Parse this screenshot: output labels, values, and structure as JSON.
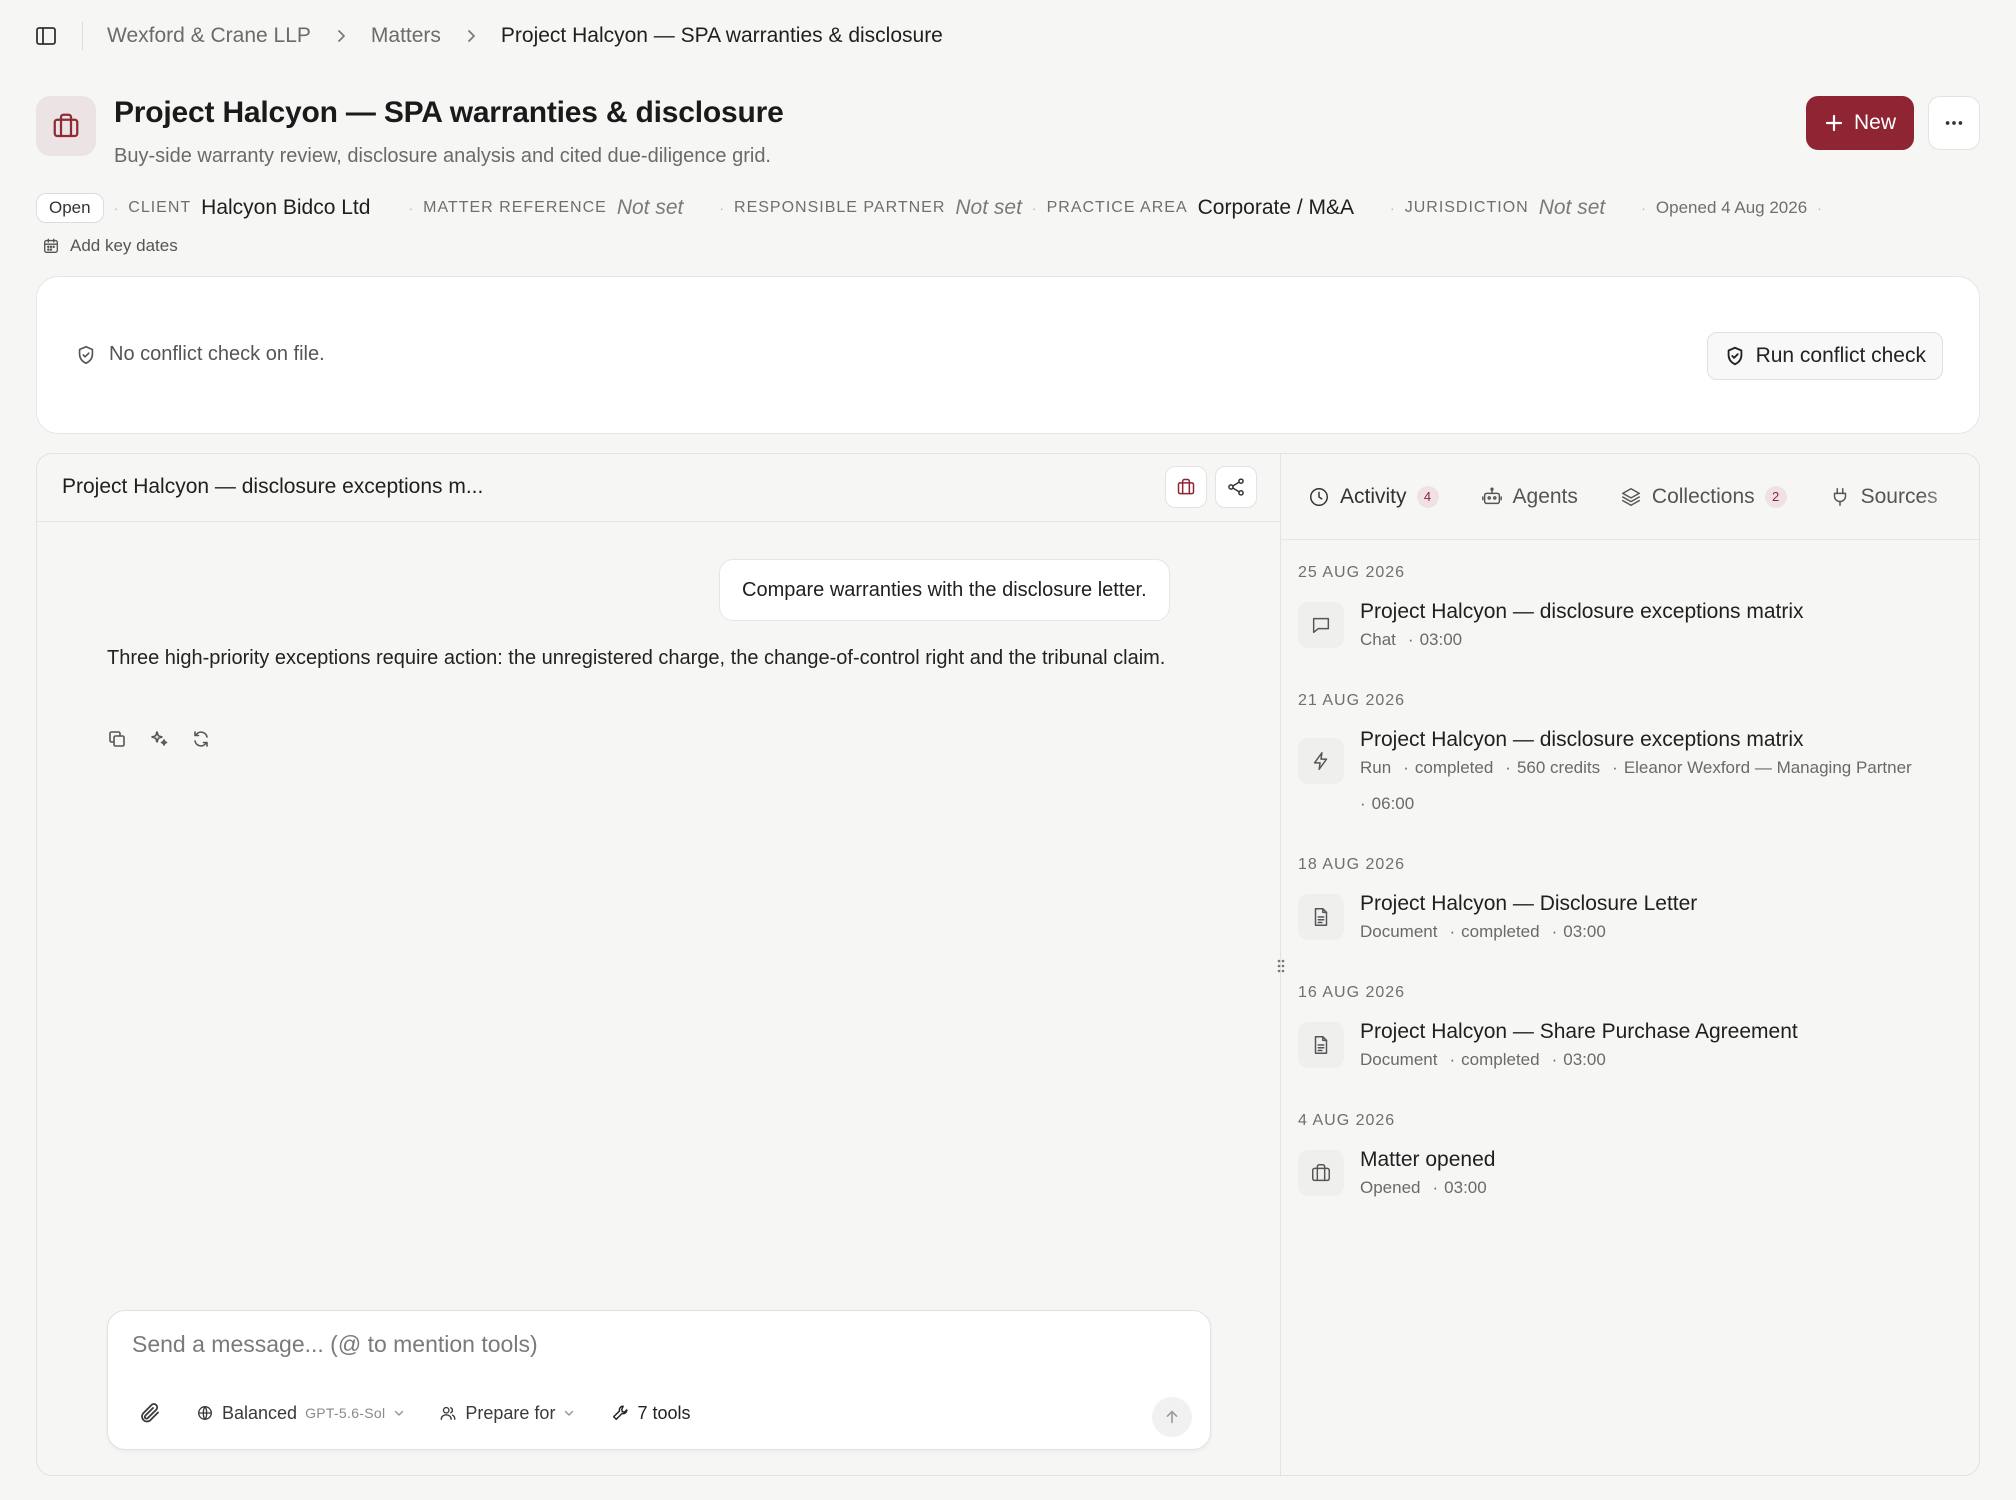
{
  "breadcrumb": {
    "items": [
      "Wexford & Crane LLP",
      "Matters",
      "Project Halcyon — SPA warranties & disclosure"
    ]
  },
  "matter": {
    "title": "Project Halcyon — SPA warranties & disclosure",
    "subtitle": "Buy-side warranty review, disclosure analysis and cited due-diligence grid.",
    "status": "Open",
    "client_label": "CLIENT",
    "client_value": "Halcyon Bidco Ltd",
    "reference_label": "MATTER REFERENCE",
    "reference_value": "Not set",
    "partner_label": "RESPONSIBLE PARTNER",
    "partner_value": "Not set",
    "practice_label": "PRACTICE AREA",
    "practice_value": "Corporate / M&A",
    "jurisdiction_label": "JURISDICTION",
    "jurisdiction_value": "Not set",
    "opened": "Opened 4 Aug 2026",
    "key_dates": "Add key dates"
  },
  "actions": {
    "new_label": "New",
    "more_icon": "ellipsis-icon"
  },
  "conflict": {
    "message": "No conflict check on file.",
    "button_label": "Run conflict check"
  },
  "chat": {
    "title": "Project Halcyon — disclosure exceptions m...",
    "user_message": "Compare warranties with the disclosure letter.",
    "assistant_message": "Three high-priority exceptions require action: the unregistered charge, the change-of-control right and the tribunal claim.",
    "composer_placeholder": "Send a message... (@ to mention tools)",
    "mode_label": "Balanced",
    "model_label": "GPT-5.6-Sol",
    "prepare_label": "Prepare for",
    "tools_label": "7 tools"
  },
  "tabs": [
    {
      "label": "Activity",
      "count": "4"
    },
    {
      "label": "Agents"
    },
    {
      "label": "Collections",
      "count": "2"
    },
    {
      "label": "Sources"
    }
  ],
  "activity": [
    {
      "date": "25 AUG 2026",
      "icon": "chat-icon",
      "title": "Project Halcyon — disclosure exceptions matrix",
      "meta": [
        "Chat",
        "03:00"
      ]
    },
    {
      "date": "21 AUG 2026",
      "icon": "bolt-icon",
      "title": "Project Halcyon — disclosure exceptions matrix",
      "meta": [
        "Run",
        "completed",
        "560 credits",
        "Eleanor Wexford — Managing Partner",
        "06:00"
      ]
    },
    {
      "date": "18 AUG 2026",
      "icon": "document-icon",
      "title": "Project Halcyon — Disclosure Letter",
      "meta": [
        "Document",
        "completed",
        "03:00"
      ]
    },
    {
      "date": "16 AUG 2026",
      "icon": "document-icon",
      "title": "Project Halcyon — Share Purchase Agreement",
      "meta": [
        "Document",
        "completed",
        "03:00"
      ]
    },
    {
      "date": "4 AUG 2026",
      "icon": "briefcase-icon",
      "title": "Matter opened",
      "meta": [
        "Opened",
        "03:00"
      ]
    }
  ],
  "colors": {
    "brand": "#8f2433",
    "brand_tint": "#ece3e4",
    "background": "#f6f6f5"
  }
}
